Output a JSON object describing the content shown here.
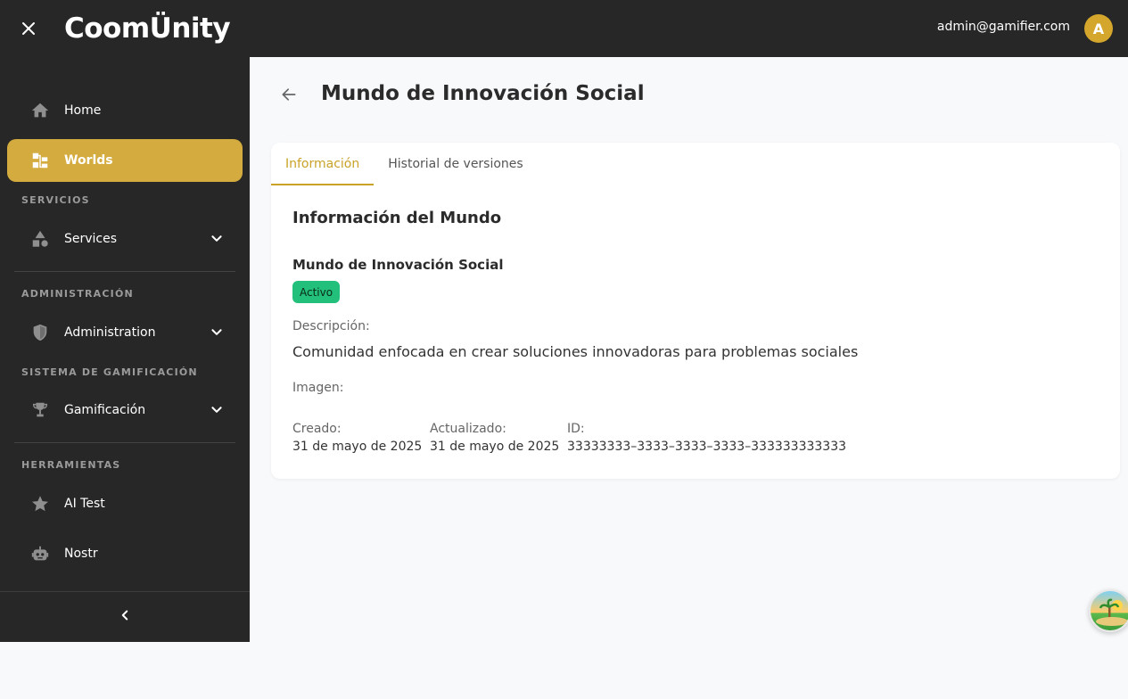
{
  "header": {
    "logo_text": "CoomÜnity",
    "user_email": "admin@gamifier.com",
    "avatar_letter": "A"
  },
  "sidebar": {
    "items": [
      {
        "label": "Home",
        "icon": "home-icon"
      },
      {
        "label": "Worlds",
        "icon": "worlds-icon",
        "active": true
      },
      {
        "label": "Services",
        "icon": "services-icon"
      },
      {
        "label": "Administration",
        "icon": "shield-icon"
      },
      {
        "label": "Gamificación",
        "icon": "trophy-icon"
      },
      {
        "label": "AI Test",
        "icon": "star-icon"
      },
      {
        "label": "Nostr",
        "icon": "robot-icon"
      }
    ],
    "sections": {
      "servicios": "SERVICIOS",
      "administracion": "ADMINISTRACIÓN",
      "gamificacion": "SISTEMA DE GAMIFICACIÓN",
      "herramientas": "HERRAMIENTAS"
    }
  },
  "main": {
    "title": "Mundo de Innovación Social",
    "tabs": [
      {
        "label": "Información",
        "active": true
      },
      {
        "label": "Historial de versiones"
      }
    ],
    "section_title": "Información del Mundo",
    "world_name": "Mundo de Innovación Social",
    "status": "Activo",
    "description_label": "Descripción:",
    "description": "Comunidad enfocada en crear soluciones innovadoras para problemas sociales",
    "image_label": "Imagen:",
    "created_label": "Creado:",
    "created_value": "31 de mayo de 2025",
    "updated_label": "Actualizado:",
    "updated_value": "31 de mayo de 2025",
    "id_label": "ID:",
    "id_value": "33333333–3333–3333–3333–333333333333"
  },
  "colors": {
    "accent": "#d4ab3e",
    "topbar": "#272727",
    "status_green": "#22c07a"
  }
}
